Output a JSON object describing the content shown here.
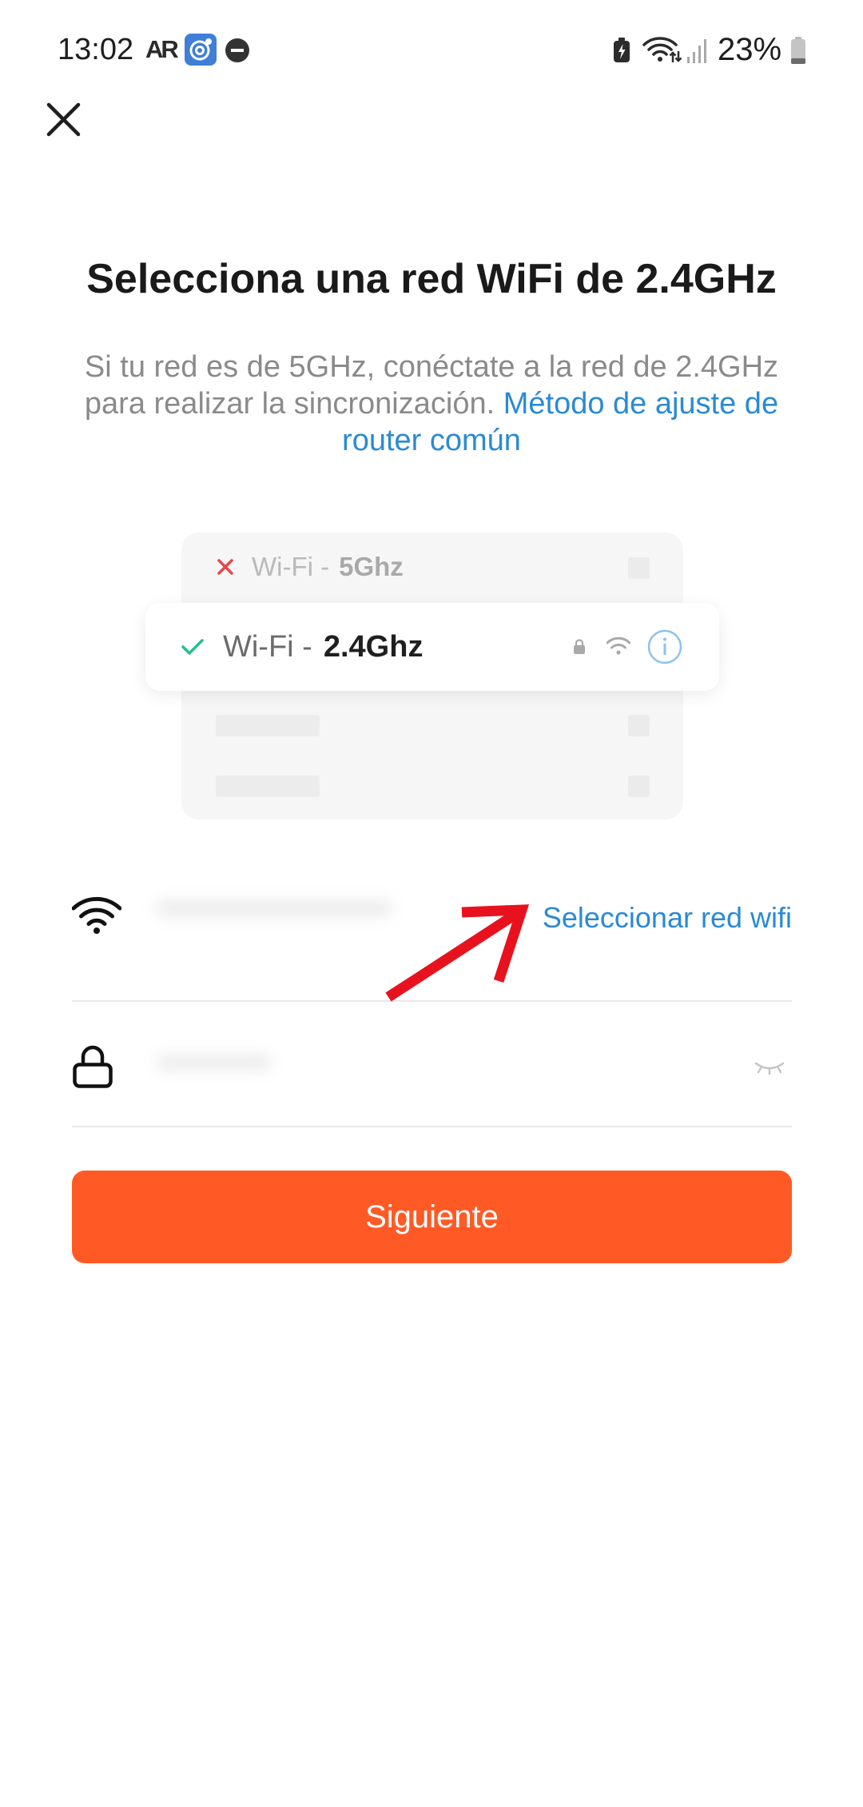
{
  "status_bar": {
    "time": "13:02",
    "ar_logo_text": "AR",
    "battery_percent": "23%",
    "battery_level": 0.23,
    "icons_left": [
      "ar-icon",
      "target-app-icon",
      "do-not-disturb-icon"
    ],
    "icons_right": [
      "battery-saver-icon",
      "wifi-activity-icon",
      "signal-icon",
      "battery-icon"
    ]
  },
  "header": {
    "close_icon": "close-icon"
  },
  "title": "Selecciona una red WiFi de 2.4GHz",
  "description": {
    "text": "Si tu red es de 5GHz, conéctate a la red de 2.4GHz para realizar la sincronización.",
    "link": "Método de ajuste de router común"
  },
  "illustration": {
    "networks": [
      {
        "prefix": "Wi-Fi -",
        "band": "5Ghz",
        "status_icon": "x-icon"
      },
      {
        "prefix": "Wi-Fi -",
        "band": "2.4Ghz",
        "status_icon": "check-icon",
        "icons": [
          "lock-icon",
          "wifi-icon",
          "info-icon"
        ]
      }
    ]
  },
  "wifi_field": {
    "icon": "wifi-icon",
    "value": "",
    "select_link": "Seleccionar red wifi"
  },
  "password_field": {
    "icon": "lock-icon",
    "value": "",
    "toggle_icon": "eye-closed-icon"
  },
  "primary_button": {
    "label": "Siguiente"
  },
  "colors": {
    "accent": "#ff5a26",
    "link": "#2b8ad3",
    "check": "#21c08b",
    "error": "#e5484d",
    "info": "#8cc3ea",
    "annotation": "#e8121e"
  }
}
